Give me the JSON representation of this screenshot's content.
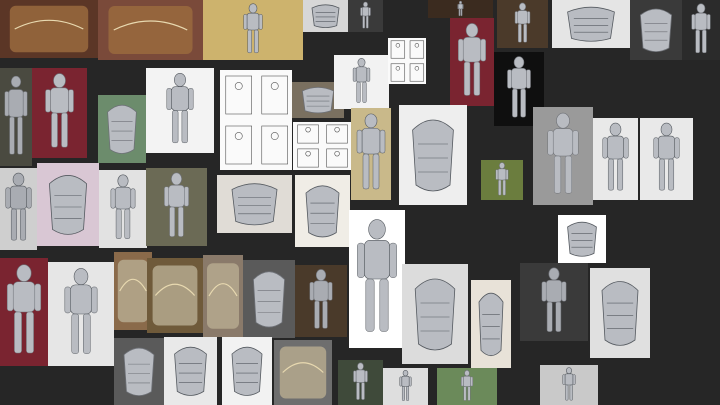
{
  "board": {
    "background": "#262626",
    "label": "",
    "tile_count": 54
  },
  "palette": {
    "steel": "#b9bcc2",
    "steel_dark": "#6e7177",
    "bronze": "#9a6a3e",
    "maroon_backdrop": "#7a2430",
    "white_backdrop": "#f2f2f2",
    "gray_backdrop": "#9a9a9a",
    "green_backdrop": "#6b7d3e"
  },
  "tiles": [
    {
      "kind": "photo",
      "bg": "#5b3626",
      "subject": "armor-closeup-bronze"
    },
    {
      "kind": "photo",
      "bg": "#7a4a3a",
      "subject": "armor-closeup-bronze"
    },
    {
      "kind": "photo",
      "bg": "#cdb36d",
      "subject": "field-knight"
    },
    {
      "kind": "photo",
      "bg": "#d7d7d7",
      "subject": "armor-parts"
    },
    {
      "kind": "photo",
      "bg": "#3a3a3a",
      "subject": "knight-standing"
    },
    {
      "kind": "photo",
      "bg": "#3b2b1f",
      "subject": "knight-standing"
    },
    {
      "kind": "photo",
      "bg": "#4b3a2a",
      "subject": "knight-standing"
    },
    {
      "kind": "photo",
      "bg": "#e5e5e5",
      "subject": "armor-parts"
    },
    {
      "kind": "photo",
      "bg": "#3a3a3a",
      "subject": "armor-parts"
    },
    {
      "kind": "photo",
      "bg": "#2b2b2b",
      "subject": "knight-standing"
    },
    {
      "kind": "photo",
      "bg": "#4a4a40",
      "subject": "knight-portrait"
    },
    {
      "kind": "photo",
      "bg": "#7a2430",
      "subject": "knight-standing"
    },
    {
      "kind": "photo",
      "bg": "#6c8c6c",
      "subject": "breastplate"
    },
    {
      "kind": "photo",
      "bg": "#f3f3f3",
      "subject": "knight-standing"
    },
    {
      "kind": "sketch",
      "bg": "#fafafa",
      "subject": "armor-sketch"
    },
    {
      "kind": "photo",
      "bg": "#7a7060",
      "subject": "gauntlet"
    },
    {
      "kind": "photo",
      "bg": "#f2f2f2",
      "subject": "knight-standing"
    },
    {
      "kind": "sketch",
      "bg": "#fafafa",
      "subject": "armor-sketch"
    },
    {
      "kind": "photo",
      "bg": "#7a2430",
      "subject": "knight-standing"
    },
    {
      "kind": "photo",
      "bg": "#0f0f0f",
      "subject": "knight-standing"
    },
    {
      "kind": "sketch",
      "bg": "#fafafa",
      "subject": "armor-sketch"
    },
    {
      "kind": "photo",
      "bg": "#c9b98a",
      "subject": "knight-standing"
    },
    {
      "kind": "photo",
      "bg": "#eeeeee",
      "subject": "pauldron"
    },
    {
      "kind": "photo",
      "bg": "#6b7d3e",
      "subject": "knight-standing"
    },
    {
      "kind": "photo",
      "bg": "#9a9a9a",
      "subject": "knight-standing"
    },
    {
      "kind": "render",
      "bg": "#e9e9e9",
      "subject": "knight-standing"
    },
    {
      "kind": "render",
      "bg": "#e9e9e9",
      "subject": "knight-standing"
    },
    {
      "kind": "photo",
      "bg": "#cfcfcf",
      "subject": "knight-portrait"
    },
    {
      "kind": "photo",
      "bg": "#d9c7d4",
      "subject": "helmet"
    },
    {
      "kind": "photo",
      "bg": "#e2e2e2",
      "subject": "knight-standing"
    },
    {
      "kind": "photo",
      "bg": "#6b6a55",
      "subject": "knight-standing"
    },
    {
      "kind": "photo",
      "bg": "#e0dcd6",
      "subject": "gauntlet"
    },
    {
      "kind": "photo",
      "bg": "#f0ede6",
      "subject": "gauntlet"
    },
    {
      "kind": "photo",
      "bg": "#ffffff",
      "subject": "sabatons"
    },
    {
      "kind": "diagram",
      "bg": "#ffffff",
      "subject": "knight-standing"
    },
    {
      "kind": "photo",
      "bg": "#7a2430",
      "subject": "knight-standing"
    },
    {
      "kind": "photo",
      "bg": "#e6e6e6",
      "subject": "knight-standing"
    },
    {
      "kind": "photo",
      "bg": "#8a6a4a",
      "subject": "armor-closeup"
    },
    {
      "kind": "photo",
      "bg": "#6f5a3a",
      "subject": "armor-closeup"
    },
    {
      "kind": "photo",
      "bg": "#8a7a6a",
      "subject": "armor-closeup"
    },
    {
      "kind": "photo",
      "bg": "#5a5a5a",
      "subject": "gauntlet"
    },
    {
      "kind": "photo",
      "bg": "#4a3a2a",
      "subject": "knight-portrait"
    },
    {
      "kind": "photo",
      "bg": "#dcdcdc",
      "subject": "gauntlet"
    },
    {
      "kind": "photo",
      "bg": "#3a3a3a",
      "subject": "knight-portrait"
    },
    {
      "kind": "photo",
      "bg": "#e0e0e0",
      "subject": "gauntlet"
    },
    {
      "kind": "photo",
      "bg": "#e8e2d8",
      "subject": "breastplate"
    },
    {
      "kind": "photo",
      "bg": "#5a5a5a",
      "subject": "breastplate"
    },
    {
      "kind": "photo",
      "bg": "#e9e9e9",
      "subject": "gauntlet"
    },
    {
      "kind": "photo",
      "bg": "#f2f2f2",
      "subject": "gauntlet"
    },
    {
      "kind": "photo",
      "bg": "#6e6e6e",
      "subject": "armor-closeup"
    },
    {
      "kind": "photo",
      "bg": "#3f4a3a",
      "subject": "knight-standing"
    },
    {
      "kind": "photo",
      "bg": "#dedede",
      "subject": "knight-standing"
    },
    {
      "kind": "photo",
      "bg": "#6b8a5a",
      "subject": "knight-standing"
    },
    {
      "kind": "photo",
      "bg": "#c9c9c9",
      "subject": "knight-standing"
    }
  ]
}
